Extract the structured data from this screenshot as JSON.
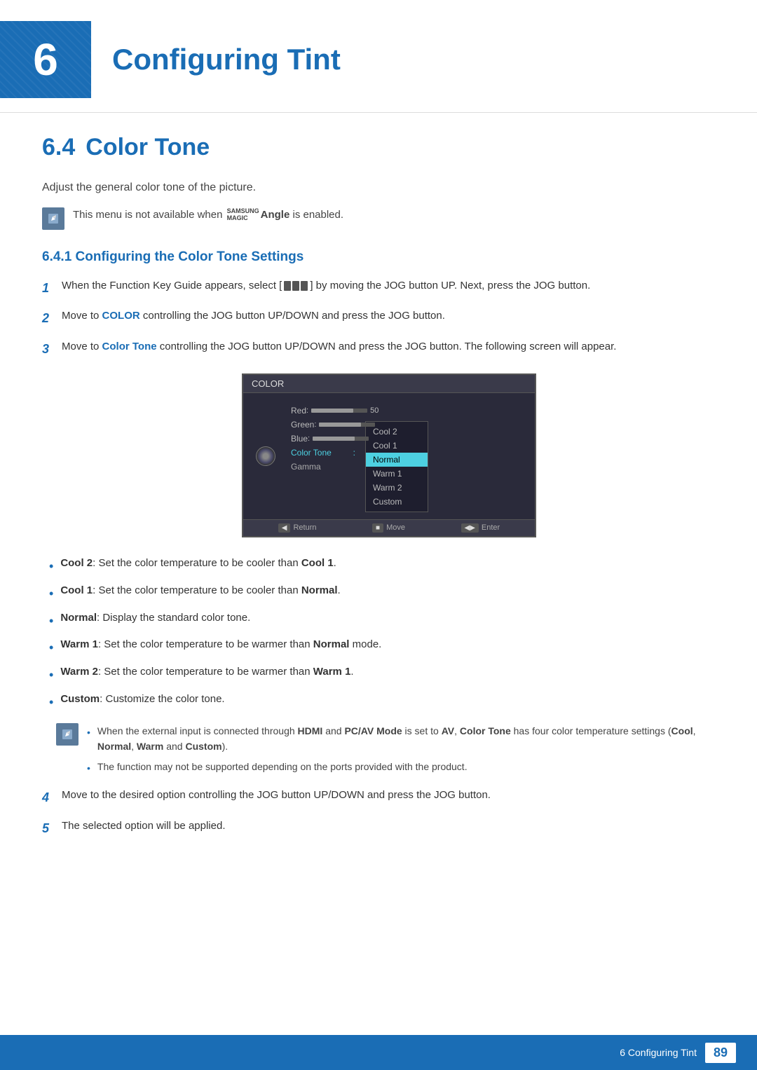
{
  "chapter": {
    "number": "6",
    "title": "Configuring Tint"
  },
  "section": {
    "number": "6.4",
    "title": "Color Tone",
    "description": "Adjust the general color tone of the picture.",
    "note": "This menu is not available when",
    "note_brand": "SAMSUNG MAGIC",
    "note_brand_word": "Angle",
    "note_suffix": "is enabled."
  },
  "subsection": {
    "number": "6.4.1",
    "title": "Configuring the Color Tone Settings"
  },
  "steps": [
    {
      "num": "1",
      "text": "When the Function Key Guide appears, select [",
      "text2": "] by moving the JOG button UP. Next, press the JOG button."
    },
    {
      "num": "2",
      "text": "Move to",
      "bold_word": "COLOR",
      "text2": "controlling the JOG button UP/DOWN and press the JOG button."
    },
    {
      "num": "3",
      "text": "Move to",
      "bold_word": "Color Tone",
      "text2": "controlling the JOG button UP/DOWN and press the JOG button. The following screen will appear."
    },
    {
      "num": "4",
      "text": "Move to the desired option controlling the JOG button UP/DOWN and press the JOG button."
    },
    {
      "num": "5",
      "text": "The selected option will be applied."
    }
  ],
  "screen": {
    "header": "COLOR",
    "menu_items": [
      {
        "label": "Red",
        "value": "50",
        "has_slider": true
      },
      {
        "label": "Green",
        "value": "50",
        "has_slider": true
      },
      {
        "label": "Blue",
        "value": "50",
        "has_slider": true
      },
      {
        "label": "Color Tone",
        "active": true
      },
      {
        "label": "Gamma"
      }
    ],
    "submenu_items": [
      {
        "label": "Cool 2"
      },
      {
        "label": "Cool 1"
      },
      {
        "label": "Normal",
        "highlighted": true
      },
      {
        "label": "Warm 1"
      },
      {
        "label": "Warm 2"
      },
      {
        "label": "Custom"
      }
    ],
    "footer": [
      {
        "key": "◀",
        "label": "Return"
      },
      {
        "key": "■",
        "label": "Move"
      },
      {
        "key": "◀▶",
        "label": "Enter"
      }
    ]
  },
  "bullets": [
    {
      "label": "Cool 2",
      "text": ": Set the color temperature to be cooler than",
      "ref": "Cool 1",
      "suffix": "."
    },
    {
      "label": "Cool 1",
      "text": ": Set the color temperature to be cooler than",
      "ref": "Normal",
      "suffix": "."
    },
    {
      "label": "Normal",
      "text": ": Display the standard color tone.",
      "ref": "",
      "suffix": ""
    },
    {
      "label": "Warm 1",
      "text": ": Set the color temperature to be warmer than",
      "ref": "Normal",
      "suffix": " mode."
    },
    {
      "label": "Warm 2",
      "text": ": Set the color temperature to be warmer than",
      "ref": "Warm 1",
      "suffix": "."
    },
    {
      "label": "Custom",
      "text": ": Customize the color tone.",
      "ref": "",
      "suffix": ""
    }
  ],
  "nested_notes": [
    {
      "text": "When the external input is connected through",
      "bold1": "HDMI",
      "text2": "and",
      "bold2": "PC/AV Mode",
      "text3": "is set to",
      "bold3": "AV",
      "text4": ", ",
      "bold4": "Color Tone",
      "text5": "has four color temperature settings (",
      "bold5": "Cool",
      "text6": ", ",
      "bold6": "Normal",
      "text7": ", ",
      "bold7": "Warm",
      "text8": "and",
      "bold8": "Custom",
      "text9": ")."
    },
    {
      "plain": "The function may not be supported depending on the ports provided with the product."
    }
  ],
  "footer": {
    "label": "6 Configuring Tint",
    "page": "89"
  }
}
